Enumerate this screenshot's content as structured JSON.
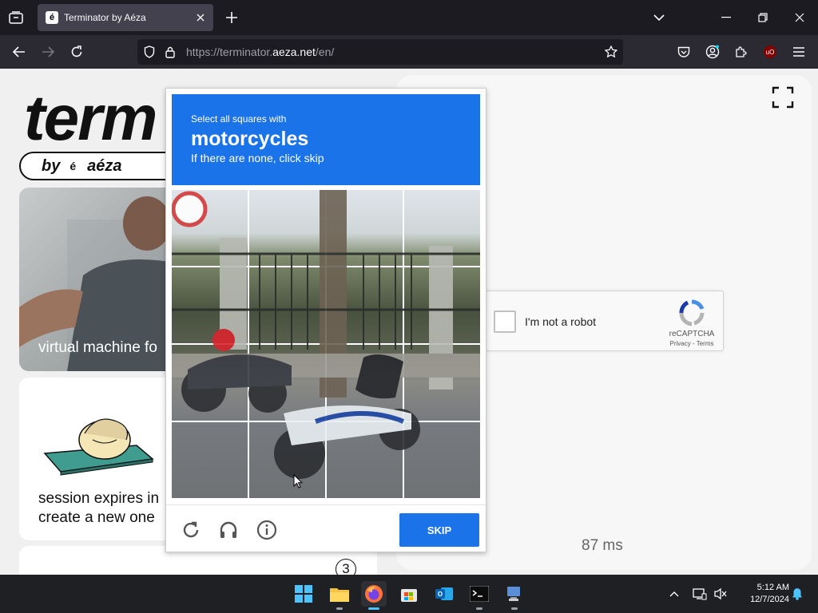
{
  "browser": {
    "tab_title": "Terminator by Aéza",
    "tab_favicon": "é",
    "url_prefix": "https://terminator.",
    "url_domain": "aeza.net",
    "url_suffix": "/en/"
  },
  "page": {
    "logo_text": "term",
    "byline_by": "by",
    "byline_mark": "é",
    "byline_name": "aéza",
    "video_label": "virtual machine fo",
    "session_line1": "session expires in",
    "session_line2": "create a new one",
    "step_number": "3",
    "latency": "87 ms"
  },
  "recaptcha": {
    "checkbox_label": "I'm not a robot",
    "brand": "reCAPTCHA",
    "links": "Privacy - Terms"
  },
  "challenge": {
    "line1": "Select all squares with",
    "target": "motorcycles",
    "line3": "If there are none, click skip",
    "skip_label": "SKIP",
    "accent": "#1a73e8"
  },
  "taskbar": {
    "time": "5:12 AM",
    "date": "12/7/2024",
    "apps": [
      "windows-start",
      "file-explorer",
      "firefox",
      "microsoft-store",
      "outlook",
      "terminal",
      "remote-desktop"
    ]
  }
}
